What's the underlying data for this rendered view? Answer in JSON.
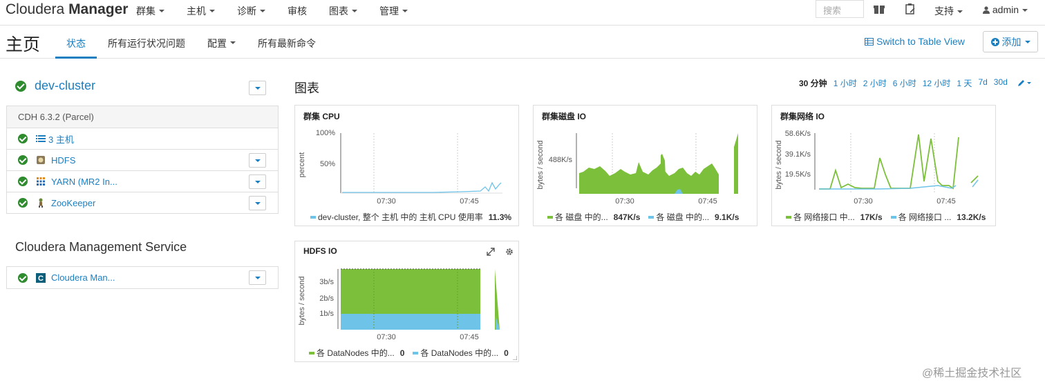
{
  "topnav": {
    "brand_light": "Cloudera ",
    "brand_bold": "Manager",
    "menu": [
      "群集",
      "主机",
      "诊断",
      "审核",
      "图表",
      "管理"
    ],
    "menu_has_caret": [
      true,
      true,
      true,
      false,
      true,
      true
    ],
    "search_placeholder": "搜索",
    "support": "支持",
    "user": "admin"
  },
  "subnav": {
    "title": "主页",
    "tabs": [
      "状态",
      "所有运行状况问题",
      "配置",
      "所有最新命令"
    ],
    "active_tab": 0,
    "switch_view": "Switch to Table View",
    "add_label": "添加"
  },
  "cluster": {
    "name": "dev-cluster",
    "version": "CDH 6.3.2 (Parcel)",
    "hosts_label": "3 主机",
    "services": [
      {
        "name": "HDFS",
        "icon": "hdfs-icon"
      },
      {
        "name": "YARN (MR2 In...",
        "icon": "yarn-icon"
      },
      {
        "name": "ZooKeeper",
        "icon": "zookeeper-icon"
      }
    ]
  },
  "management": {
    "title": "Cloudera Management Service",
    "service": "Cloudera Man..."
  },
  "charts": {
    "heading": "图表",
    "ranges": [
      "30 分钟",
      "1 小时",
      "2 小时",
      "6 小时",
      "12 小时",
      "1 天",
      "7d",
      "30d"
    ],
    "selected_range": 0
  },
  "colors": {
    "green": "#7bbf3a",
    "blue": "#6ec3e8",
    "link": "#1a7fc1",
    "ok": "#2e8b2e"
  },
  "chart_data": [
    {
      "type": "line",
      "title": "群集 CPU",
      "ylabel": "percent",
      "y_ticks": [
        "100%",
        "50%"
      ],
      "x_ticks": [
        "07:30",
        "07:45"
      ],
      "series": [
        {
          "name": "dev-cluster, 整个 主机 中的 主机 CPU 使用率",
          "latest": "11.3%",
          "color": "#6ec3e8"
        }
      ]
    },
    {
      "type": "area",
      "title": "群集磁盘 IO",
      "ylabel": "bytes / second",
      "y_ticks": [
        "488K/s"
      ],
      "x_ticks": [
        "07:30",
        "07:45"
      ],
      "series": [
        {
          "name": "各 磁盘 中的...",
          "latest": "847K/s",
          "color": "#7bbf3a"
        },
        {
          "name": "各 磁盘 中的...",
          "latest": "9.1K/s",
          "color": "#6ec3e8"
        }
      ]
    },
    {
      "type": "line",
      "title": "群集网络 IO",
      "ylabel": "bytes / second",
      "y_ticks": [
        "58.6K/s",
        "39.1K/s",
        "19.5K/s"
      ],
      "x_ticks": [
        "07:30",
        "07:45"
      ],
      "series": [
        {
          "name": "各 网络接口 中...",
          "latest": "17K/s",
          "color": "#7bbf3a"
        },
        {
          "name": "各 网络接口 ...",
          "latest": "13.2K/s",
          "color": "#6ec3e8"
        }
      ]
    },
    {
      "type": "area",
      "title": "HDFS IO",
      "ylabel": "bytes / second",
      "y_ticks": [
        "3b/s",
        "2b/s",
        "1b/s"
      ],
      "x_ticks": [
        "07:30",
        "07:45"
      ],
      "series": [
        {
          "name": "各 DataNodes 中的...",
          "latest": "0",
          "color": "#7bbf3a"
        },
        {
          "name": "各 DataNodes 中的...",
          "latest": "0",
          "color": "#6ec3e8"
        }
      ]
    }
  ],
  "watermark": "@稀土掘金技术社区"
}
